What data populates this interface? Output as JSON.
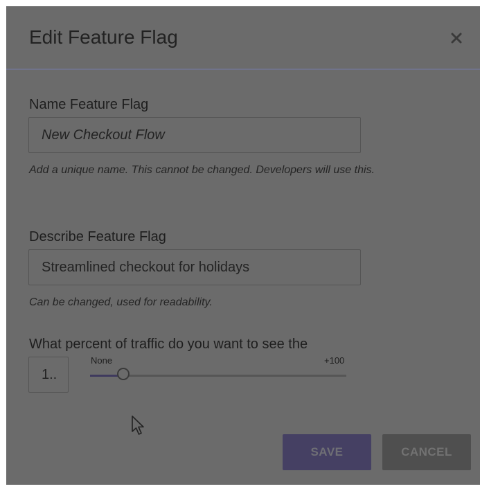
{
  "dialog": {
    "title": "Edit Feature Flag",
    "close_icon": "close-icon"
  },
  "name_field": {
    "label": "Name Feature Flag",
    "placeholder": "New Checkout Flow",
    "helper": "Add a unique name. This cannot be changed. Developers will use this."
  },
  "description_field": {
    "label": "Describe Feature Flag",
    "value": "Streamlined checkout for holidays",
    "helper": "Can be changed, used for readability."
  },
  "traffic": {
    "label": "What percent of traffic do you want to see the",
    "input_value": "1..",
    "slider_min_label": "None",
    "slider_max_label": "+100",
    "slider_value_percent": 13
  },
  "actions": {
    "save_label": "SAVE",
    "cancel_label": "CANCEL"
  },
  "colors": {
    "overlay": "#6b6b6b",
    "primary": "#454063",
    "secondary": "#4f4f4f"
  }
}
